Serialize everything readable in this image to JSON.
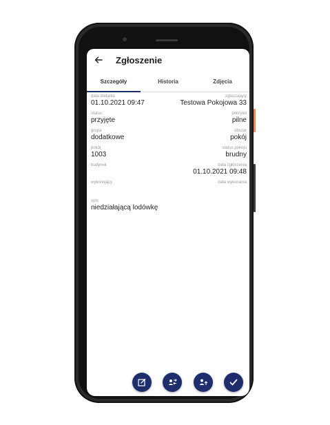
{
  "appbar": {
    "title": "Zgłoszenie",
    "back_icon": "arrow-left-icon"
  },
  "tabs": [
    {
      "label": "Szczegóły",
      "active": true
    },
    {
      "label": "Historia",
      "active": false
    },
    {
      "label": "Zdjęcia",
      "active": false
    }
  ],
  "details": [
    {
      "left_label": "data dodania",
      "left_value": "01.10.2021 09:47",
      "right_label": "zgłaszający",
      "right_value": "Testowa Pokojowa 33"
    },
    {
      "left_label": "status",
      "left_value": "przyjęte",
      "right_label": "priorytet",
      "right_value": "pilne"
    },
    {
      "left_label": "grupa",
      "left_value": "dodatkowe",
      "right_label": "obszar",
      "right_value": "pokój"
    },
    {
      "left_label": "pokój",
      "left_value": "1003",
      "right_label": "status pokoju",
      "right_value": "brudny"
    },
    {
      "left_label": "budynek",
      "left_value": "",
      "right_label": "data zgłoszenia",
      "right_value": "01.10.2021 09:48"
    },
    {
      "left_label": "wykonujący",
      "left_value": "",
      "right_label": "data wykonania",
      "right_value": ""
    }
  ],
  "description": {
    "label": "opis",
    "value": "niedziałającą lodówkę"
  },
  "actions": [
    {
      "icon": "edit-note-icon"
    },
    {
      "icon": "reassign-user-icon"
    },
    {
      "icon": "user-upload-icon"
    },
    {
      "icon": "check-icon"
    }
  ],
  "colors": {
    "primary": "#1e2d6b",
    "label": "#9a9a9a",
    "text": "#1e1e1e"
  }
}
